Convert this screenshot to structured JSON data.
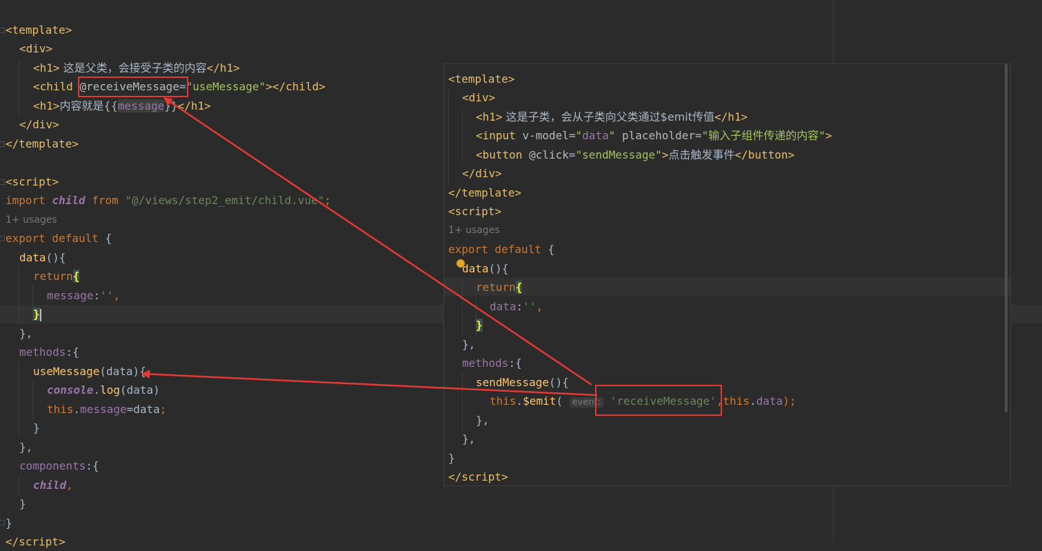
{
  "parent_editor": {
    "l1": {
      "open": "<",
      "tag": "template",
      "close": ">"
    },
    "l2": {
      "open": "<",
      "tag": "div",
      "close": ">"
    },
    "l3": {
      "open": "<",
      "tag": "h1",
      "close": ">",
      "text": " 这是父类，会接受子类的内容",
      "end_open": "</",
      "end_tag": "h1",
      "end_close": ">"
    },
    "l4": {
      "open": "<",
      "tag": "child",
      "sp": " ",
      "attr": "@receiveMessage",
      "eq": "=",
      "q1": "\"",
      "val": "useMessage",
      "q2": "\"",
      "close": ">",
      "end": "</",
      "end_tag": "child",
      "end_close": ">"
    },
    "l5": {
      "open": "<",
      "tag": "h1",
      "close": ">",
      "text": "内容就是{{",
      "var": "message",
      "text2": "}}",
      "end": "</",
      "end_tag": "h1",
      "end_close": ">"
    },
    "l6": {
      "open": "</",
      "tag": "div",
      "close": ">"
    },
    "l7": {
      "open": "</",
      "tag": "template",
      "close": ">"
    },
    "l8": {
      "open": "<",
      "tag": "script",
      "close": ">"
    },
    "l9": {
      "kw1": "import",
      "sp1": " ",
      "name": "child",
      "sp2": " ",
      "kw2": "from",
      "sp3": " ",
      "str": "\"@/views/step2_emit/child.vue\"",
      "semi": ";"
    },
    "usages": "1+ usages",
    "l10": {
      "kw": "export default",
      "rest": " {"
    },
    "l11": {
      "fn": "data",
      "rest": "(){"
    },
    "l12": {
      "kw": "return",
      "brace": "{"
    },
    "l13": {
      "prop": "message",
      "colon": ":",
      "str": "''",
      "comma": ","
    },
    "l14": {
      "brace": "}"
    },
    "l15": {
      "text": "},"
    },
    "l16": {
      "prop": "methods",
      "rest": ":{"
    },
    "l17": {
      "fn": "useMessage",
      "rest": "(data){"
    },
    "l18": {
      "obj": "console",
      "dot": ".",
      "fn": "log",
      "rest": "(data)"
    },
    "l19": {
      "kw": "this",
      "dot": ".",
      "prop": "message",
      "rest": "=data",
      "semi": ";"
    },
    "l20": {
      "text": "}"
    },
    "l21": {
      "text": "},"
    },
    "l22": {
      "prop": "components",
      "rest": ":{"
    },
    "l23": {
      "name": "child",
      "comma": ","
    },
    "l24": {
      "text": "}"
    },
    "l25": {
      "text": "}"
    },
    "l26": {
      "open": "</",
      "tag": "script",
      "close": ">"
    }
  },
  "child_popup": {
    "l1": {
      "open": "<",
      "tag": "template",
      "close": ">"
    },
    "l2": {
      "open": "<",
      "tag": "div",
      "close": ">"
    },
    "l3": {
      "open": "<",
      "tag": "h1",
      "close": ">",
      "text": " 这是子类，会从子类向父类通过$emit传值",
      "end": "</",
      "end_tag": "h1",
      "end_close": ">"
    },
    "l4": {
      "open": "<",
      "tag": "input",
      "sp": " ",
      "attr1": "v-model",
      "eq1": "=",
      "q1": "\"",
      "val1": "data",
      "q2": "\"",
      "sp2": " ",
      "attr2": "placeholder",
      "eq2": "=",
      "q3": "\"",
      "val2": "输入子组件传递的内容",
      "q4": "\"",
      "close": ">"
    },
    "l5": {
      "open": "<",
      "tag": "button",
      "sp": " ",
      "attr": "@click",
      "eq": "=",
      "q1": "\"",
      "val": "sendMessage",
      "q2": "\"",
      "close": ">",
      "text": "点击触发事件",
      "end": "</",
      "end_tag": "button",
      "end_close": ">"
    },
    "l6": {
      "open": "</",
      "tag": "div",
      "close": ">"
    },
    "l7": {
      "open": "</",
      "tag": "template",
      "close": ">"
    },
    "l8": {
      "open": "<",
      "tag": "script",
      "close": ">"
    },
    "usages": "1+ usages",
    "l9": {
      "kw": "export default",
      "rest": " {"
    },
    "l10": {
      "fn": "data",
      "rest": "(){"
    },
    "l11": {
      "kw": "return",
      "brace": "{"
    },
    "l12": {
      "prop": "data",
      "colon": ":",
      "str": "''",
      "comma": ","
    },
    "l13": {
      "brace": "}"
    },
    "l14": {
      "text": "},"
    },
    "l15": {
      "prop": "methods",
      "rest": ":{"
    },
    "l16": {
      "fn": "sendMessage",
      "rest": "(){"
    },
    "l17": {
      "kw": "this",
      "dot": ".",
      "fn": "$emit",
      "paren": "( ",
      "hint": "event:",
      "sp": " ",
      "str": "'receiveMessage'",
      "comma": ",",
      "kw2": "this",
      "dot2": ".",
      "prop": "data",
      "rest": ");"
    },
    "l18": {
      "text": "},"
    },
    "l19": {
      "text": "},"
    },
    "l20": {
      "text": "}"
    },
    "l21": {
      "open": "</",
      "tag": "script",
      "close": ">"
    }
  },
  "colors": {
    "highlight_box": "#e53935",
    "arrow": "#e53935",
    "background": "#2b2b2b"
  }
}
